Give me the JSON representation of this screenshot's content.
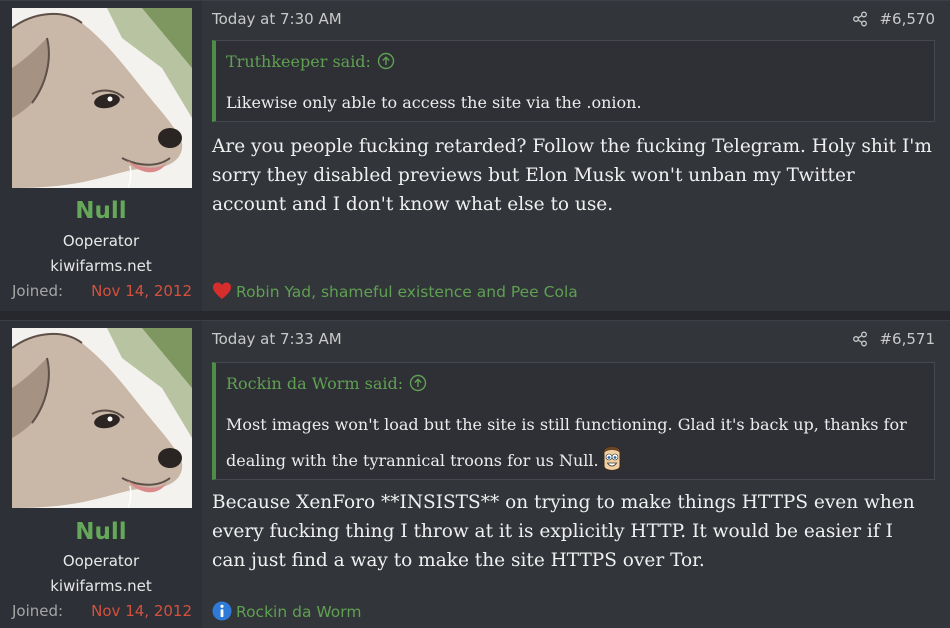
{
  "posts": [
    {
      "user": {
        "name": "Null",
        "title": "Ooperator",
        "banner": "kiwifarms.net",
        "joined_label": "Joined:",
        "joined_date": "Nov 14, 2012"
      },
      "time": "Today at 7:30 AM",
      "number": "#6,570",
      "quote": {
        "author": "Truthkeeper said:",
        "text": "Likewise only able to access the site via the .onion."
      },
      "message": "Are you people fucking retarded? Follow the fucking Telegram. Holy shit I'm sorry they disabled previews but Elon Musk won't unban my Twitter account and I don't know what else to use.",
      "reactions": {
        "icon": "heart-icon",
        "text": "Robin Yad, shameful existence and Pee Cola"
      }
    },
    {
      "user": {
        "name": "Null",
        "title": "Ooperator",
        "banner": "kiwifarms.net",
        "joined_label": "Joined:",
        "joined_date": "Nov 14, 2012"
      },
      "time": "Today at 7:33 AM",
      "number": "#6,571",
      "quote": {
        "author": "Rockin da Worm said:",
        "text": "Most images won't load but the site is still functioning. Glad it's back up, thanks for dealing with the tyrannical troons for us Null."
      },
      "message": "Because XenForo **INSISTS** on trying to make things HTTPS even when every fucking thing I throw at it is explicitly HTTP. It would be easier if I can just find a way to make the site HTTPS over Tor.",
      "reactions": {
        "icon": "informative-icon",
        "text": "Rockin da Worm"
      }
    }
  ],
  "colors": {
    "accent": "#5fa052",
    "username": "#66a85a",
    "joined_date": "#d4513f",
    "background": "#32353a"
  }
}
